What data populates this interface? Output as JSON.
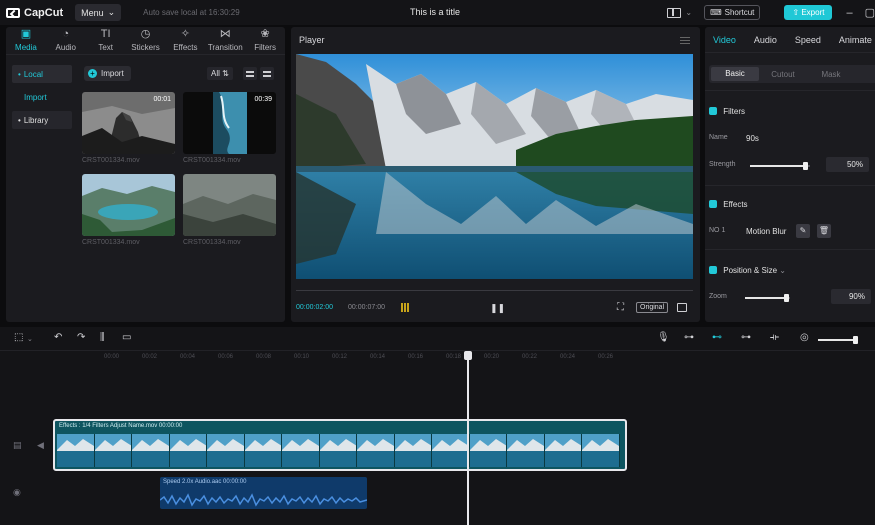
{
  "app": {
    "name": "CapCut",
    "menu_label": "Menu",
    "autosave": "Auto save local at 16:30:29",
    "title": "This is a title",
    "shortcut_label": "Shortcut",
    "export_label": "Export",
    "accent_color": "#22c9d8"
  },
  "media_tabs": [
    {
      "label": "Media",
      "icon": "media-icon"
    },
    {
      "label": "Audio",
      "icon": "audio-icon"
    },
    {
      "label": "Text",
      "icon": "text-icon"
    },
    {
      "label": "Stickers",
      "icon": "stickers-icon"
    },
    {
      "label": "Effects",
      "icon": "effects-icon"
    },
    {
      "label": "Transition",
      "icon": "transition-icon"
    },
    {
      "label": "Filters",
      "icon": "filters-icon"
    }
  ],
  "media_side": {
    "local": "Local",
    "import": "Import",
    "library": "Library"
  },
  "media_toolbar": {
    "import_label": "Import",
    "filter_label": "All"
  },
  "media_items": [
    {
      "name": "CRST001334.mov",
      "duration": "00:01"
    },
    {
      "name": "CRST001334.mov",
      "duration": "00:39"
    },
    {
      "name": "CRST001334.mov",
      "duration": ""
    },
    {
      "name": "CRST001334.mov",
      "duration": ""
    }
  ],
  "player": {
    "title": "Player",
    "current_time": "00:00:02:00",
    "total_time": "00:00:07:00",
    "ratio_label": "Original"
  },
  "right_panel": {
    "tabs": [
      "Video",
      "Audio",
      "Speed",
      "Animate"
    ],
    "subtabs": [
      "Basic",
      "Cutout",
      "Mask"
    ],
    "filters": {
      "title": "Filters",
      "name_label": "Name",
      "name_value": "90s",
      "strength_label": "Strength",
      "strength_value": "50%"
    },
    "effects": {
      "title": "Effects",
      "slot_label": "NO 1",
      "effect_name": "Motion Blur"
    },
    "position": {
      "title": "Position & Size",
      "zoom_label": "Zoom",
      "zoom_value": "90%"
    }
  },
  "timeline": {
    "ticks": [
      "00:00",
      "00:02",
      "00:04",
      "00:06",
      "00:08",
      "00:10",
      "00:12",
      "00:14",
      "00:16",
      "00:18",
      "00:20",
      "00:22",
      "00:24",
      "00:26"
    ],
    "main_clip_label": "Effects : 1/4   Filters   Adjust   Name.mov   00:00:00",
    "audio_clip_label": "Speed 2.0x   Audio.aac   00:00:00"
  }
}
